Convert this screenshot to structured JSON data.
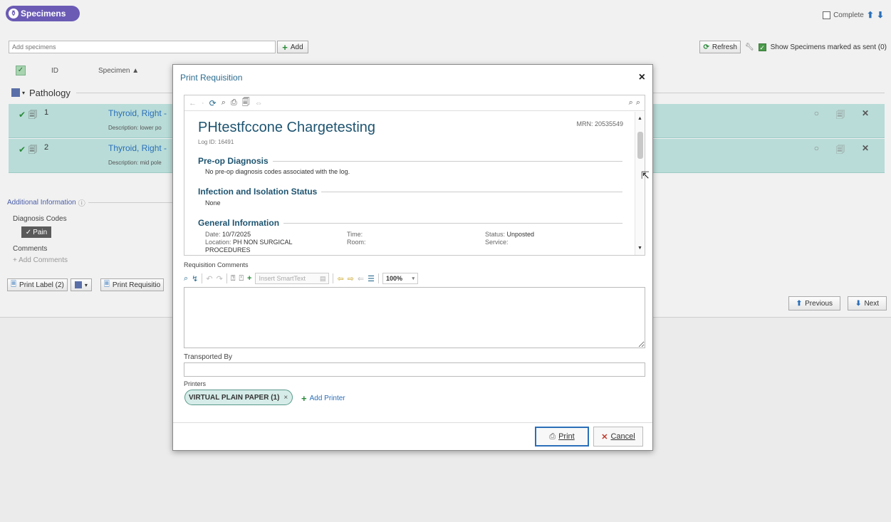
{
  "header": {
    "title": "Specimens",
    "complete_label": "Complete",
    "up_arrow": "⬆",
    "down_arrow": "⬇"
  },
  "add_bar": {
    "placeholder": "Add specimens",
    "add_label": "Add"
  },
  "refresh_bar": {
    "refresh_label": "Refresh",
    "show_sent_label": "Show Specimens marked as sent (0)"
  },
  "table": {
    "col_id": "ID",
    "col_specimen": "Specimen ▲"
  },
  "group": {
    "label": "Pathology"
  },
  "specimens": [
    {
      "id": "1",
      "name": "Thyroid, Right -",
      "desc_label": "Description:",
      "desc_value": "lower po"
    },
    {
      "id": "2",
      "name": "Thyroid, Right -",
      "desc_label": "Description:",
      "desc_value": "mid pole"
    }
  ],
  "additional": {
    "title": "Additional Information",
    "diagnosis_label": "Diagnosis Codes",
    "diagnosis_chip": "Pain",
    "comments_label": "Comments",
    "add_comments": "Add Comments"
  },
  "bottom": {
    "print_label": "Print Label (2)",
    "print_requisition": "Print Requisitio",
    "previous": "Previous",
    "next": "Next"
  },
  "dialog": {
    "title": "Print Requisition",
    "close": "×",
    "patient_name": "PHtestfccone Chargetesting",
    "mrn": "MRN: 20535549",
    "log_id": "Log ID: 16491",
    "preop_title": "Pre-op Diagnosis",
    "preop_text": "No pre-op diagnosis codes associated with the log.",
    "infection_title": "Infection and Isolation Status",
    "infection_text": "None",
    "general_title": "General Information",
    "date_label": "Date:",
    "date_value": "10/7/2025",
    "location_label": "Location:",
    "location_value": "PH NON SURGICAL",
    "location_value2": "PROCEDURES",
    "time_label": "Time:",
    "room_label": "Room:",
    "status_label": "Status:",
    "status_value": "Unposted",
    "service_label": "Service:",
    "req_comments_label": "Requisition Comments",
    "smarttext_placeholder": "Insert SmartText",
    "zoom": "100%",
    "transported_by_label": "Transported By",
    "printers_label": "Printers",
    "printer_chip": "VIRTUAL PLAIN PAPER (1)",
    "add_printer": "Add Printer",
    "print_button": "Print",
    "cancel_button": "Cancel"
  }
}
